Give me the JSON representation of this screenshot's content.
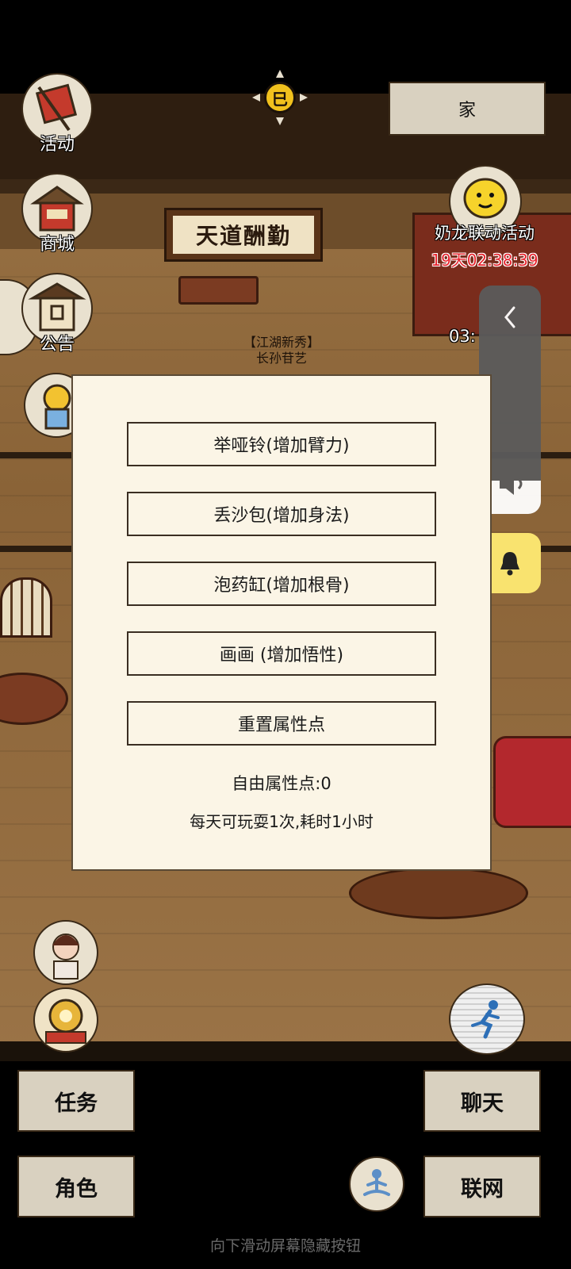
{
  "top": {
    "home_label": "家",
    "sun_glyph": "巳"
  },
  "sidebar": {
    "activity_label": "活动",
    "shop_label": "商城",
    "notice_label": "公告"
  },
  "scene": {
    "sign_text": "天道酬勤",
    "npc_tag_line1": "【江湖新秀】",
    "npc_tag_line2": "长孙苷艺"
  },
  "event": {
    "title": "奶龙联动活动",
    "timer": "19天02:38:39",
    "timer_partial": "03:"
  },
  "dialog": {
    "options": [
      {
        "label": "举哑铃(增加臂力)"
      },
      {
        "label": "丢沙包(增加身法)"
      },
      {
        "label": "泡药缸(增加根骨)"
      },
      {
        "label": "画画  (增加悟性)"
      },
      {
        "label": "重置属性点"
      }
    ],
    "free_points": "自由属性点:0",
    "play_note": "每天可玩耍1次,耗时1小时"
  },
  "bottom": {
    "task_label": "任务",
    "chat_label": "聊天",
    "role_label": "角色",
    "network_label": "联网",
    "hint": "向下滑动屏幕隐藏按钮"
  },
  "colors": {
    "dialog_bg": "#fbf5e6",
    "button_bg": "#d9d1c0",
    "timer_red": "#e8242e",
    "bell_yellow": "#f9e36f"
  }
}
